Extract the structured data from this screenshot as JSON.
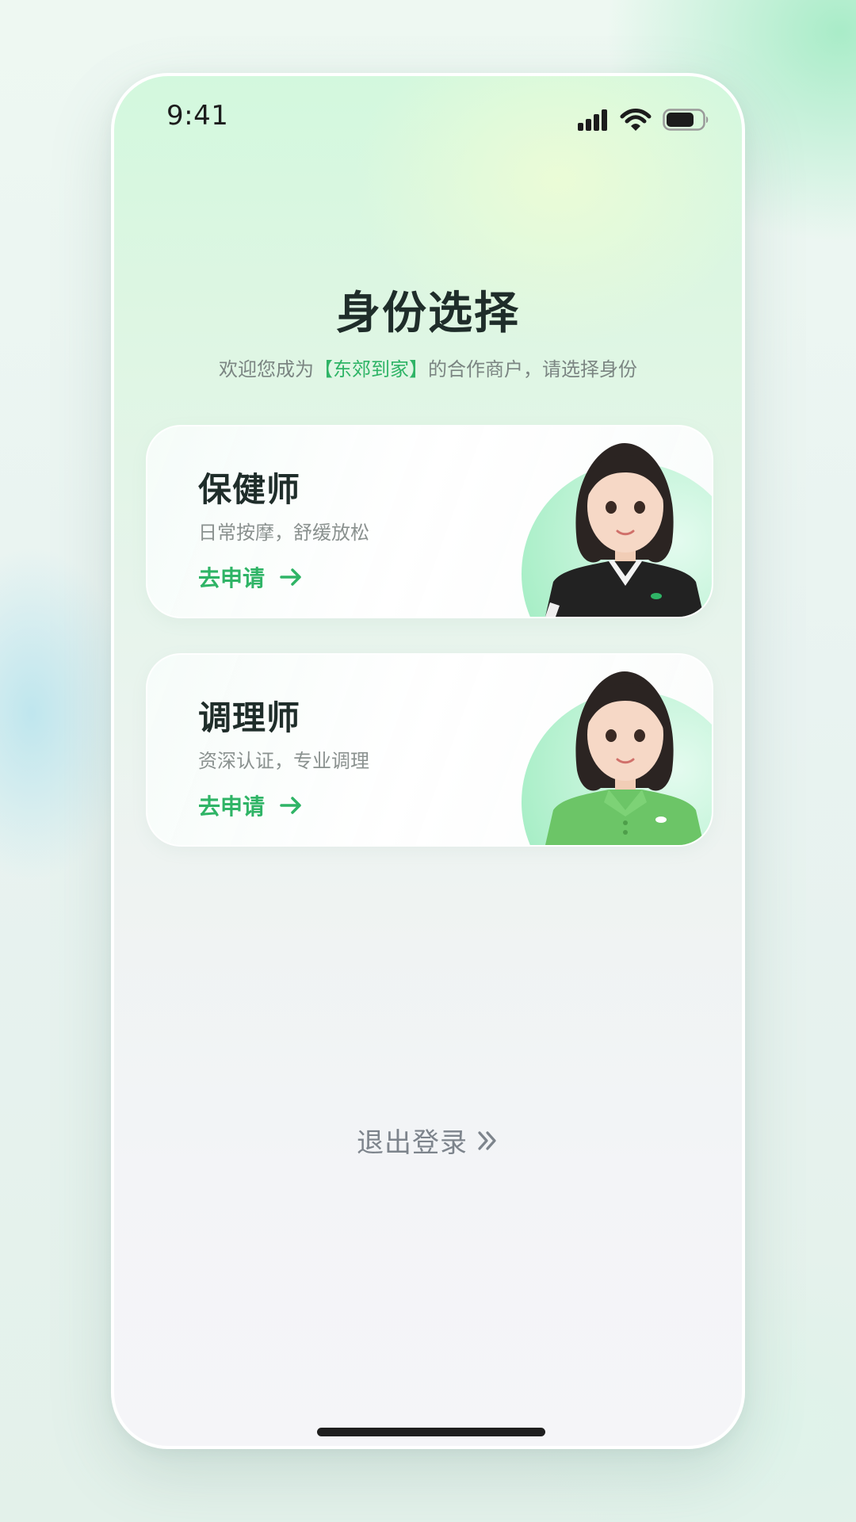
{
  "status_bar": {
    "time": "9:41",
    "icons": [
      "signal-icon",
      "wifi-icon",
      "battery-icon"
    ]
  },
  "header": {
    "title": "身份选择",
    "subtitle_prefix": "欢迎您成为",
    "brand": "【东郊到家】",
    "subtitle_suffix": "的合作商户，请选择身份"
  },
  "cards": [
    {
      "title": "保健师",
      "description": "日常按摩，舒缓放松",
      "action_label": "去申请",
      "shirt_color": "#222222"
    },
    {
      "title": "调理师",
      "description": "资深认证，专业调理",
      "action_label": "去申请",
      "shirt_color": "#6cc567"
    }
  ],
  "logout": {
    "label": "退出登录"
  },
  "colors": {
    "accent": "#2fb466",
    "title": "#1f2d2a",
    "muted": "#8a918f"
  }
}
